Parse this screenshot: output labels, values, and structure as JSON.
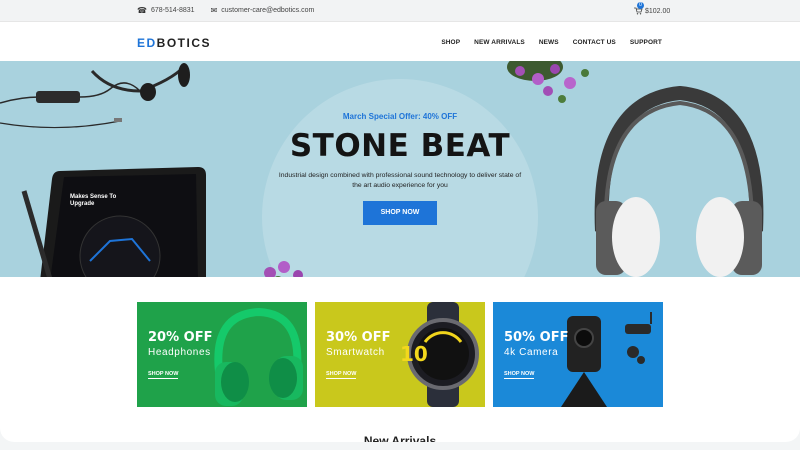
{
  "topbar": {
    "phone": "678-514-8831",
    "email": "customer-care@edbotics.com",
    "cart_count": "0",
    "cart_total": "$102.00"
  },
  "header": {
    "logo_ed": "ED",
    "logo_rest": "BOTICS",
    "nav": [
      "SHOP",
      "NEW ARRIVALS",
      "NEWS",
      "CONTACT US",
      "SUPPORT"
    ]
  },
  "hero": {
    "offer": "March Special Offer: 40% OFF",
    "title": "STONE BEAT",
    "description": "Industrial design combined with professional sound technology to deliver state of the art audio experience for you",
    "button": "SHOP NOW",
    "tablet_text": "Makes Sense To Upgrade",
    "colors": {
      "background": "#a9d2de",
      "accent": "#1e74d8"
    }
  },
  "promos": [
    {
      "off": "20% OFF",
      "name": "Headphones",
      "link": "SHOP NOW",
      "color": "#1fa24a"
    },
    {
      "off": "30% OFF",
      "name": "Smartwatch",
      "link": "SHOP NOW",
      "color": "#c9c81c"
    },
    {
      "off": "50% OFF",
      "name": "4k Camera",
      "link": "SHOP NOW",
      "color": "#1b89d8"
    }
  ],
  "watch_display": "10",
  "section_title": "New Arrivals"
}
